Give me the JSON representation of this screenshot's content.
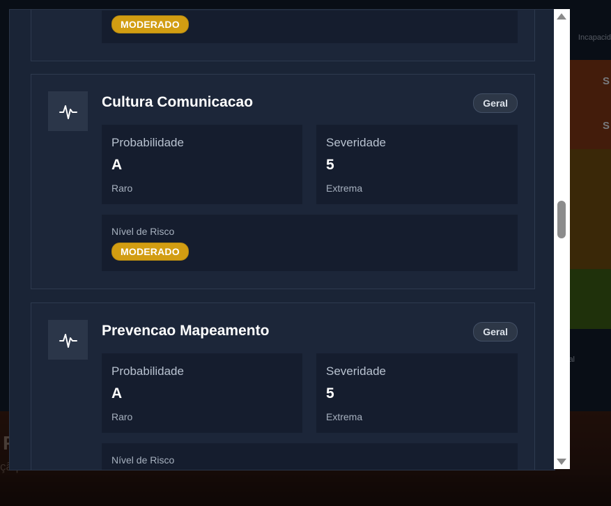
{
  "background": {
    "side_label": "Incapacid",
    "side_cells": [
      "S",
      "S"
    ],
    "side_label_2": "al",
    "big_letter": "P",
    "subtitle": "çã personalizada baseada em cenários"
  },
  "modal": {
    "top_card": {
      "risk_badge": "MODERADO"
    },
    "cards": [
      {
        "title": "Cultura Comunicacao",
        "tag": "Geral",
        "probability_label": "Probabilidade",
        "probability_value": "A",
        "probability_desc": "Raro",
        "severity_label": "Severidade",
        "severity_value": "5",
        "severity_desc": "Extrema",
        "risk_label": "Nível de Risco",
        "risk_badge": "MODERADO"
      },
      {
        "title": "Prevencao Mapeamento",
        "tag": "Geral",
        "probability_label": "Probabilidade",
        "probability_value": "A",
        "probability_desc": "Raro",
        "severity_label": "Severidade",
        "severity_value": "5",
        "severity_desc": "Extrema",
        "risk_label": "Nível de Risco"
      }
    ]
  },
  "colors": {
    "modal_bg": "#1a2436",
    "card_bg": "#1c2639",
    "panel_bg": "#151d2e",
    "moderate": "#d29d12"
  },
  "icons": {
    "card_icon": "activity-pulse-icon"
  }
}
